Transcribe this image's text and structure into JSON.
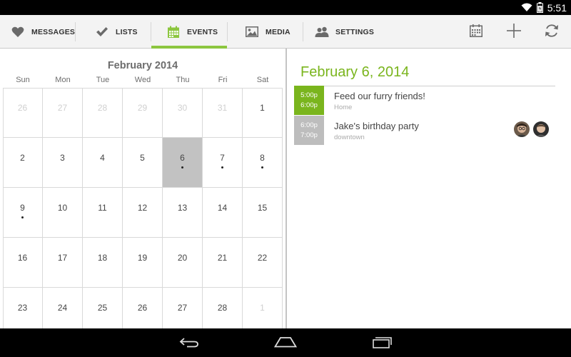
{
  "status": {
    "time": "5:51"
  },
  "tabs": [
    {
      "label": "MESSAGES",
      "icon": "heart-icon"
    },
    {
      "label": "LISTS",
      "icon": "checkmark-icon"
    },
    {
      "label": "EVENTS",
      "icon": "calendar-icon",
      "active": true
    },
    {
      "label": "MEDIA",
      "icon": "image-icon"
    },
    {
      "label": "SETTINGS",
      "icon": "people-icon"
    }
  ],
  "actions": [
    "calendar-today-icon",
    "add-icon",
    "refresh-icon"
  ],
  "calendar": {
    "month_title": "February 2014",
    "weekdays": [
      "Sun",
      "Mon",
      "Tue",
      "Wed",
      "Thu",
      "Fri",
      "Sat"
    ],
    "days": [
      {
        "n": "26",
        "muted": true
      },
      {
        "n": "27",
        "muted": true
      },
      {
        "n": "28",
        "muted": true
      },
      {
        "n": "29",
        "muted": true
      },
      {
        "n": "30",
        "muted": true
      },
      {
        "n": "31",
        "muted": true
      },
      {
        "n": "1"
      },
      {
        "n": "2"
      },
      {
        "n": "3"
      },
      {
        "n": "4"
      },
      {
        "n": "5"
      },
      {
        "n": "6",
        "selected": true,
        "event": true
      },
      {
        "n": "7",
        "event": true
      },
      {
        "n": "8",
        "event": true
      },
      {
        "n": "9",
        "event": true
      },
      {
        "n": "10"
      },
      {
        "n": "11"
      },
      {
        "n": "12"
      },
      {
        "n": "13"
      },
      {
        "n": "14"
      },
      {
        "n": "15"
      },
      {
        "n": "16"
      },
      {
        "n": "17"
      },
      {
        "n": "18"
      },
      {
        "n": "19"
      },
      {
        "n": "20"
      },
      {
        "n": "21"
      },
      {
        "n": "22"
      },
      {
        "n": "23"
      },
      {
        "n": "24"
      },
      {
        "n": "25"
      },
      {
        "n": "26"
      },
      {
        "n": "27"
      },
      {
        "n": "28"
      },
      {
        "n": "1",
        "muted": true
      }
    ]
  },
  "events_pane": {
    "date_heading": "February 6, 2014",
    "events": [
      {
        "start": "5:00p",
        "end": "6:00p",
        "title": "Feed our furry friends!",
        "location": "Home",
        "color": "#7ab51d"
      },
      {
        "start": "6:00p",
        "end": "7:00p",
        "title": "Jake's birthday party",
        "location": "downtown",
        "color": "#bdbdbd",
        "attendees": 2
      }
    ]
  },
  "colors": {
    "accent": "#8cc63f",
    "heading_green": "#7ab51d",
    "selected_day": "#c2c2c2"
  }
}
